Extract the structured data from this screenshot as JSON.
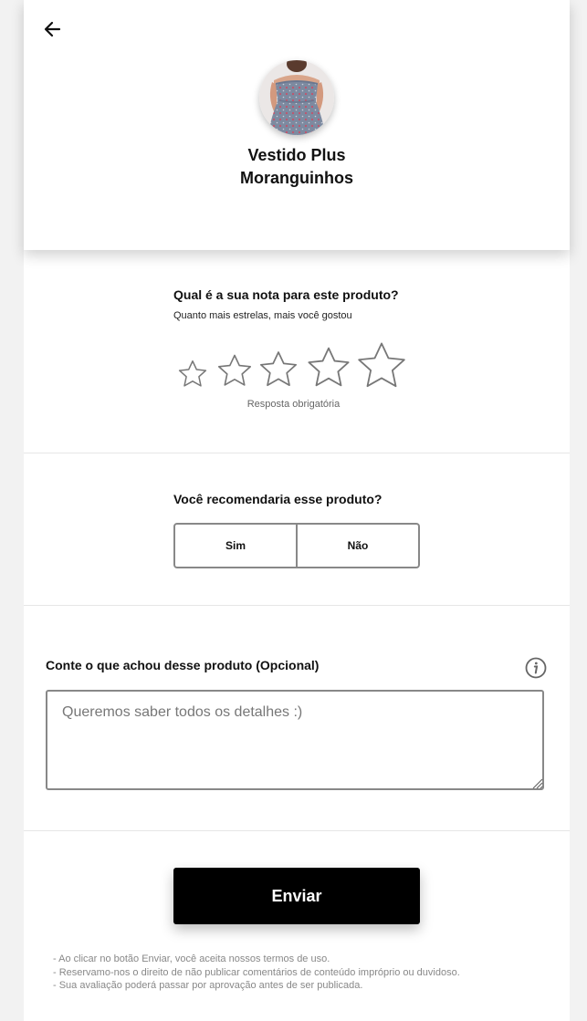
{
  "header": {
    "back_icon": "arrow-left-icon",
    "product_title_line1": "Vestido Plus",
    "product_title_line2": "Moranguinhos"
  },
  "rating": {
    "question": "Qual é a sua nota para este produto?",
    "hint": "Quanto mais estrelas, mais você gostou",
    "stars_total": 5,
    "stars_selected": 0,
    "required_text": "Resposta obrigatória"
  },
  "recommend": {
    "question": "Você recomendaria esse produto?",
    "yes_label": "Sim",
    "no_label": "Não"
  },
  "comment": {
    "label": "Conte o que achou desse produto (Opcional)",
    "placeholder": "Queremos saber todos os detalhes :)",
    "value": "",
    "info_icon": "info-icon"
  },
  "submit": {
    "label": "Enviar"
  },
  "terms": [
    "- Ao clicar no botão Enviar, você aceita nossos termos de uso.",
    "- Reservamo-nos o direito de não publicar comentários de conteúdo impróprio ou duvidoso.",
    "- Sua avaliação poderá passar por aprovação antes de ser publicada."
  ],
  "colors": {
    "primary_button": "#000000",
    "border": "#888888",
    "background": "#f2f2f2"
  }
}
